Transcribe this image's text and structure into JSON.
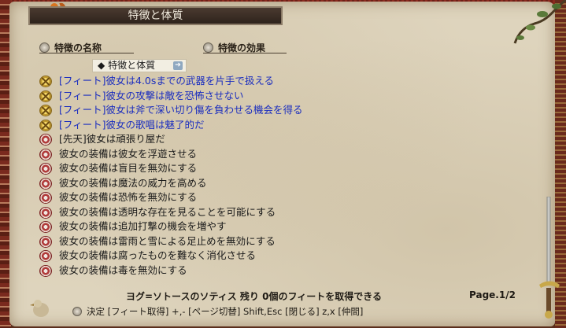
{
  "window": {
    "title": "特徴と体質"
  },
  "columns": {
    "name_header": "特徴の名称",
    "effect_header": "特徴の効果"
  },
  "category": {
    "label": "特徴と体質"
  },
  "entries": [
    {
      "kind": "feat",
      "text": "[フィート]彼女は4.0sまでの武器を片手で扱える"
    },
    {
      "kind": "feat",
      "text": "[フィート]彼女の攻撃は敵を恐怖させない"
    },
    {
      "kind": "feat",
      "text": "[フィート]彼女は斧で深い切り傷を負わせる機会を得る"
    },
    {
      "kind": "feat",
      "text": "[フィート]彼女の歌唱は魅了的だ"
    },
    {
      "kind": "trait",
      "text": "[先天]彼女は頑張り屋だ"
    },
    {
      "kind": "trait",
      "text": "彼女の装備は彼女を浮遊させる"
    },
    {
      "kind": "trait",
      "text": "彼女の装備は盲目を無効にする"
    },
    {
      "kind": "trait",
      "text": "彼女の装備は魔法の威力を高める"
    },
    {
      "kind": "trait",
      "text": "彼女の装備は恐怖を無効にする"
    },
    {
      "kind": "trait",
      "text": "彼女の装備は透明な存在を見ることを可能にする"
    },
    {
      "kind": "trait",
      "text": "彼女の装備は追加打撃の機会を増やす"
    },
    {
      "kind": "trait",
      "text": "彼女の装備は雷雨と雪による足止めを無効にする"
    },
    {
      "kind": "trait",
      "text": "彼女の装備は腐ったものを難なく消化させる"
    },
    {
      "kind": "trait",
      "text": "彼女の装備は毒を無効にする"
    }
  ],
  "footer": {
    "status": "ヨグ=ソトースのソティス 残り 0個のフィートを取得できる",
    "page": "Page.1/2",
    "help": "決定 [フィート取得]  +,- [ページ切替]  Shift,Esc [閉じる]  z,x [仲間]"
  },
  "colors": {
    "feat_text": "#1a2dbf",
    "trait_text": "#1a1a1a",
    "parchment": "#ded4bd"
  }
}
